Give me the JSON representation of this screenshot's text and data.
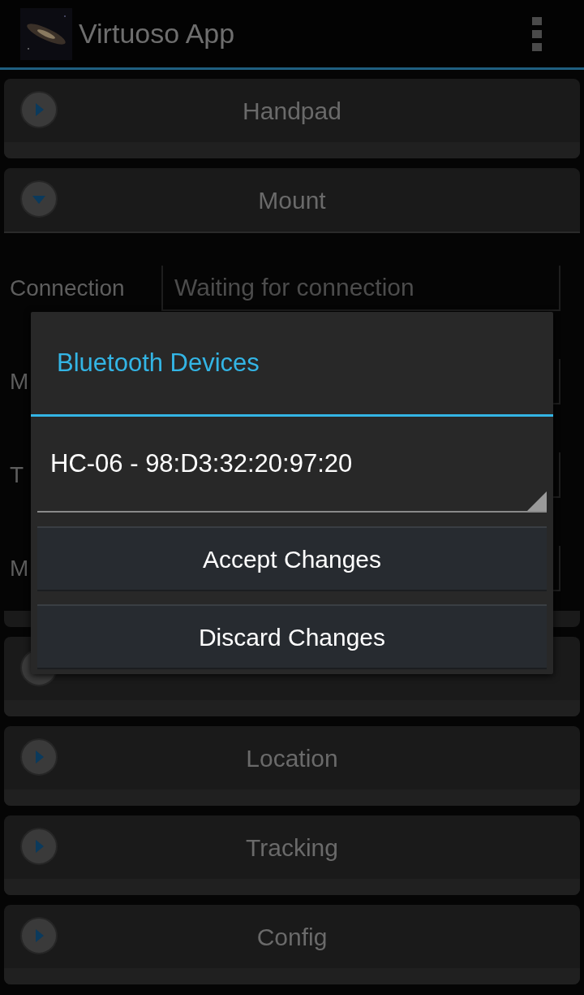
{
  "app_bar": {
    "title": "Virtuoso App"
  },
  "sections": [
    {
      "title": "Handpad",
      "expanded": false
    },
    {
      "title": "Mount",
      "expanded": true,
      "fields": [
        {
          "label": "Connection",
          "value": "Waiting for connection"
        },
        {
          "label": "M"
        },
        {
          "label": "T"
        },
        {
          "label": "M"
        }
      ]
    },
    {
      "expanded": false
    },
    {
      "title": "Location",
      "expanded": false
    },
    {
      "title": "Tracking",
      "expanded": false
    },
    {
      "title": "Config",
      "expanded": false
    }
  ],
  "dialog": {
    "title": "Bluetooth Devices",
    "spinner": {
      "value": "HC-06 - 98:D3:32:20:97:20"
    },
    "buttons": [
      "Accept Changes",
      "Discard Changes"
    ]
  }
}
